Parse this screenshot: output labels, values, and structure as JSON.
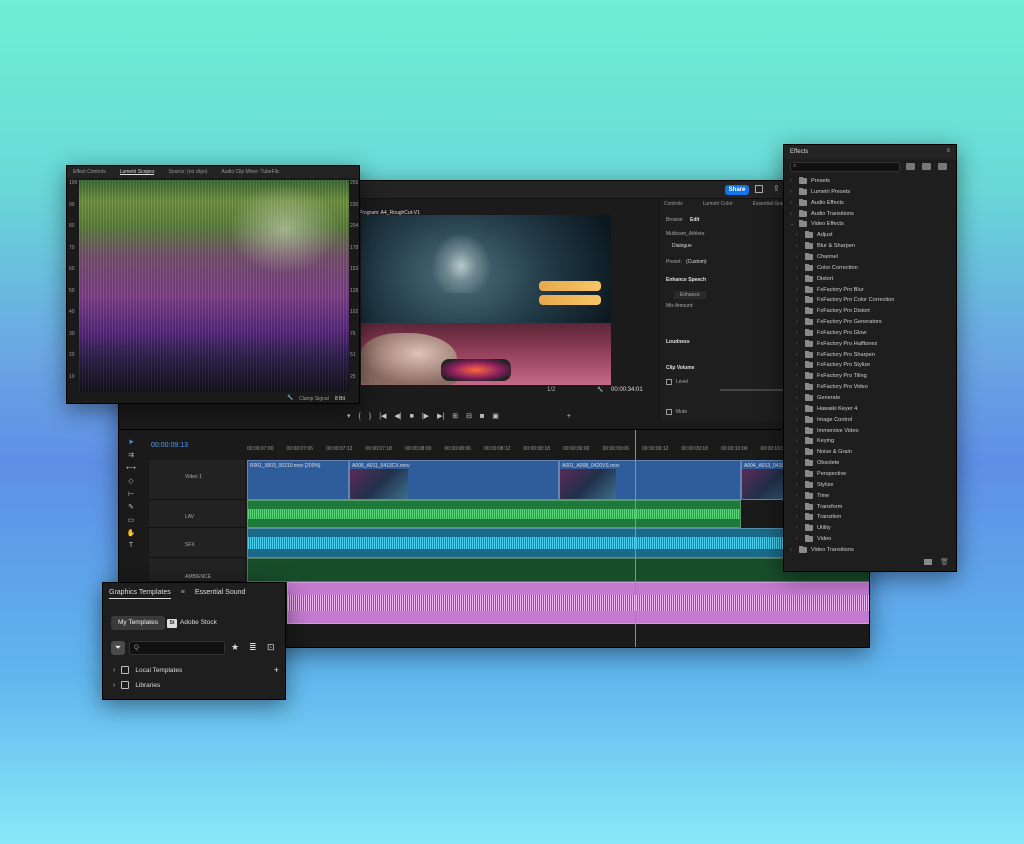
{
  "scopes": {
    "tabs": [
      "Effect Controls",
      "Lumetri Scopes",
      "Source: (no clips)",
      "Audio Clip Mixer: TubeFilc"
    ],
    "left_scale": [
      "100",
      "90",
      "80",
      "70",
      "60",
      "50",
      "40",
      "30",
      "20",
      "10"
    ],
    "right_scale": [
      "255",
      "230",
      "204",
      "178",
      "153",
      "128",
      "102",
      "76",
      "51",
      "25"
    ],
    "footer": "Clamp Signal",
    "footer_value": "8 Bit"
  },
  "main": {
    "share_label": "Share",
    "program_tab": "Program: A4_RoughCut-V1",
    "zoom": "1/2",
    "timecode_out": "00:00:34:01",
    "right_tabs": [
      "Controls",
      "Lumetri Color",
      "Essential Graphics"
    ],
    "browse_label": "Browse",
    "edit_label": "Edit",
    "clip_name": "Multicam_Athlete",
    "dialogue_label": "Dialogue",
    "preset_label": "Preset:",
    "preset_value": "(Custom)",
    "enhance_speech": "Enhance Speech",
    "enhance_btn": "Enhance",
    "mix_amount": "Mix Amount:",
    "loudness": "Loudness",
    "clip_volume": "Clip Volume",
    "level_label": "Level",
    "mute_label": "Mute"
  },
  "timeline": {
    "timecode": "00:00:09:13",
    "ruler": [
      "00:00:07:00",
      "00:00:07:06",
      "00:00:07:12",
      "00:00:07:18",
      "00:00:08:00",
      "00:00:08:06",
      "00:00:08:12",
      "00:00:08:18",
      "00:00:09:00",
      "00:00:09:06",
      "00:00:09:12",
      "00:00:09:18",
      "00:00:10:00",
      "00:00:10:06"
    ],
    "v1_label": "Video 1",
    "clip_v1a": "R001_0003_00210.mov [200%]",
    "clip_v1b": "A006_A011_0413CX.mov",
    "clip_v1c": "A001_A008_0420VS.mov",
    "clip_v1d": "A004_A013_0418C.mov",
    "a1_label": "LAV",
    "a2_label": "SFX",
    "a3_label": "AMBIENCE"
  },
  "effects": {
    "title": "Effects",
    "top": [
      "Presets",
      "Lumetri Presets",
      "Audio Effects",
      "Audio Transitions",
      "Video Effects"
    ],
    "video_effects": [
      "Adjust",
      "Blur & Sharpen",
      "Channel",
      "Color Correction",
      "Distort",
      "FxFactory Pro Blur",
      "FxFactory Pro Color Correction",
      "FxFactory Pro Distort",
      "FxFactory Pro Generators",
      "FxFactory Pro Glow",
      "FxFactory Pro Halftones",
      "FxFactory Pro Sharpen",
      "FxFactory Pro Stylize",
      "FxFactory Pro Tiling",
      "FxFactory Pro Video",
      "Generate",
      "Hawaiki Keyer 4",
      "Image Control",
      "Immersive Video",
      "Keying",
      "Noise & Grain",
      "Obsolete",
      "Perspective",
      "Stylize",
      "Time",
      "Transform",
      "Transition",
      "Utility",
      "Video"
    ],
    "bottom": "Video Transitions"
  },
  "graphics": {
    "tab1": "Graphics Templates",
    "tab2": "Essential Sound",
    "my_templates": "My Templates",
    "stock_badge": "St",
    "adobe_stock": "Adobe Stock",
    "search_placeholder": "Q·",
    "local_templates": "Local Templates",
    "libraries": "Libraries"
  }
}
